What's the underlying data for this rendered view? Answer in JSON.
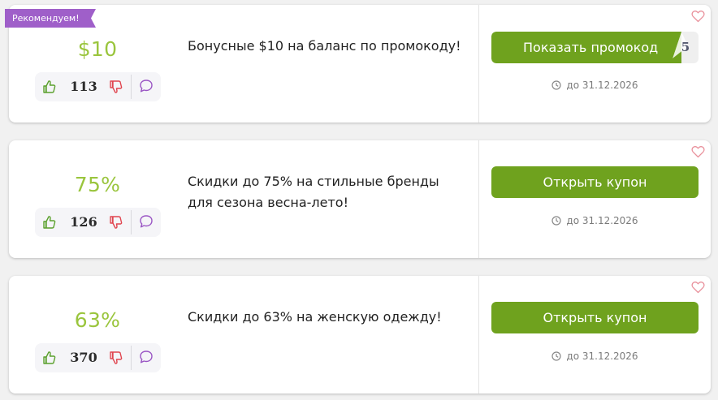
{
  "badge": {
    "recommended": "Рекомендуем!"
  },
  "colors": {
    "accent_green": "#6fa21e",
    "discount_green": "#9ac53d",
    "ribbon_purple": "#9f5fc9",
    "heart_pink": "#e9919c"
  },
  "icons": {
    "like": "thumbs-up-icon",
    "dislike": "thumbs-down-icon",
    "comment": "comment-icon",
    "favorite": "heart-icon",
    "clock": "clock-icon"
  },
  "coupons": [
    {
      "discount": "$10",
      "votes": "113",
      "title": "Бонусные $10 на баланс по промокоду!",
      "button_label": "Показать промокод",
      "code_tail": "5",
      "expiry": "до 31.12.2026"
    },
    {
      "discount": "75%",
      "votes": "126",
      "title": "Скидки до 75% на стильные бренды для сезона весна-лето!",
      "button_label": "Открыть купон",
      "expiry": "до 31.12.2026"
    },
    {
      "discount": "63%",
      "votes": "370",
      "title": "Скидки до 63% на женскую одежду!",
      "button_label": "Открыть купон",
      "expiry": "до 31.12.2026"
    }
  ]
}
